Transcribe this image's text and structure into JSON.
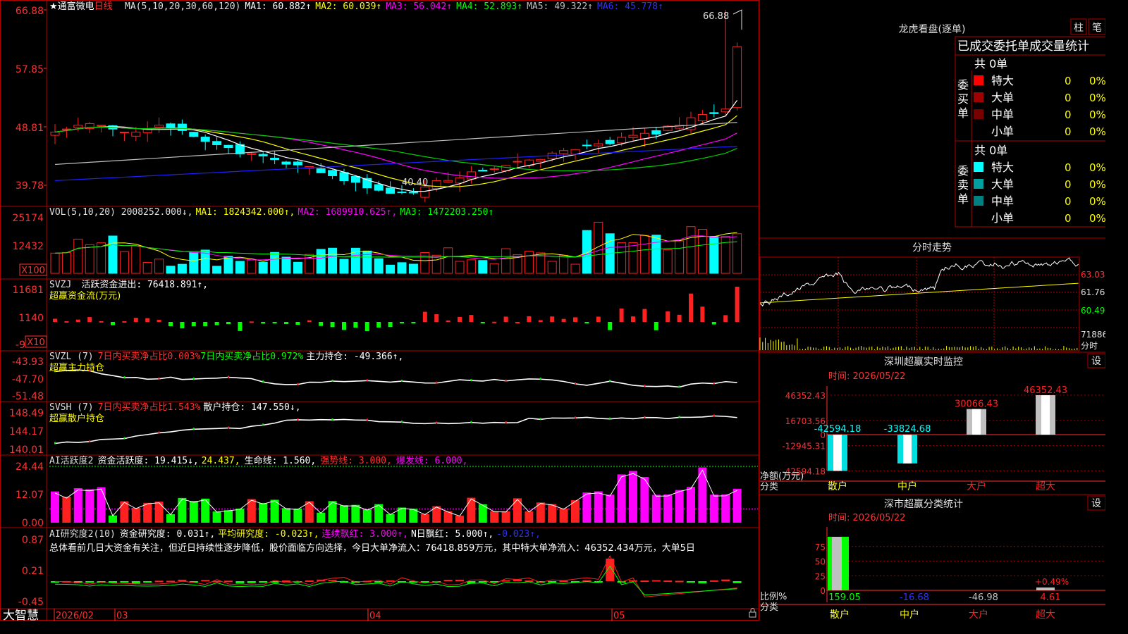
{
  "stock": {
    "name": "通富微电",
    "period": "日线",
    "brand": "大智慧"
  },
  "colors": {
    "up": "#ff2020",
    "down": "#00ffff",
    "grid": "#a00000",
    "axis": "#ff3030",
    "ma1": "#ffffff",
    "ma2": "#ffff00",
    "ma3": "#ff00ff",
    "ma4": "#00d000",
    "ma5": "#c0c0c0",
    "ma6": "#2020ff",
    "green": "#00ff00",
    "magenta": "#ff00ff",
    "yellow": "#ffff00"
  },
  "kline": {
    "header": {
      "star": "★",
      "ma_def": "MA(5,10,20,30,60,120)",
      "ma1": "MA1: 60.882↑",
      "ma2": "MA2: 60.039↑",
      "ma3": "MA3: 56.042↑",
      "ma4": "MA4: 52.893↑",
      "ma5": "MA5: 49.322↑",
      "ma6": "MA6: 45.778↑"
    },
    "axis": [
      "66.88",
      "57.85",
      "48.81",
      "39.78"
    ],
    "high_label": "66.88",
    "low_label": "40.40"
  },
  "vol": {
    "header": {
      "def": "VOL(5,10,20) 2008252.000↓,",
      "ma1": "MA1: 1824342.000↑,",
      "ma2": "MA2: 1689910.625↑,",
      "ma3": "MA3: 1472203.250↑"
    },
    "axis": [
      "25174",
      "12432"
    ],
    "unit": "X100"
  },
  "svzj": {
    "header": {
      "name": "SVZJ",
      "text": "活跃资金进出: 76418.891↑,",
      "sub": "超赢资金流(万元)"
    },
    "axis": [
      "11681",
      "1140",
      "-9"
    ],
    "unit": "X10"
  },
  "svzl": {
    "header": {
      "name": "SVZL (7)",
      "t1": "7日内买卖净占比0.003%",
      "t2": "7日内买卖净占比0.972%",
      "t3": "主力持仓: -49.366↑,",
      "sub": "超赢主力持仓"
    },
    "axis": [
      "-43.93",
      "-47.70",
      "-51.48"
    ]
  },
  "svsh": {
    "header": {
      "name": "SVSH (7)",
      "t1": "7日内买卖净占比1.543%",
      "t2": "散户持仓: 147.550↓,",
      "sub": "超赢散户持仓"
    },
    "axis": [
      "148.49",
      "144.17",
      "140.01"
    ]
  },
  "ai2": {
    "header": {
      "name": "AI活跃度2",
      "t1": "资金活跃度: 19.415↓,",
      "t2": "24.437,",
      "t3": "生命线: 1.560,",
      "t4": "强势线: 3.000,",
      "t5": "爆发线: 6.000,"
    },
    "axis": [
      "24.44",
      "12.07",
      "0.00"
    ]
  },
  "ai3": {
    "header": {
      "name": "AI研究度2(10)",
      "t1": "资金研究度: 0.031↑,",
      "t2": "平均研究度: -0.023↑,",
      "t3": "连续飘红: 3.000↑,",
      "t4": "N日飘红: 5.000↑,",
      "t5": "-0.023↑,"
    },
    "desc": "总体看前几日大资金有关注，但近日持续性逐步降低，股价面临方向选择，今日大单净流入：76418.859万元，其中特大单净流入：46352.434万元，大单5日",
    "axis": [
      "0.87",
      "0.21",
      "-0.45"
    ]
  },
  "dates": {
    "d1": "2026/02",
    "d2": "03",
    "d3": "04",
    "d4": "05"
  },
  "dragon": {
    "title": "龙虎看盘(逐单)",
    "btn1": "柱",
    "btn2": "笔",
    "subtitle": "已成交委托单成交量统计",
    "buy_label": "委买单",
    "sell_label": "委卖单",
    "buy_total": "共 0单",
    "sell_total": "共 0单",
    "buy_rows": [
      {
        "name": "特大",
        "count": "0",
        "pct": "0%"
      },
      {
        "name": "大单",
        "count": "0",
        "pct": "0%"
      },
      {
        "name": "中单",
        "count": "0",
        "pct": "0%"
      },
      {
        "name": "小单",
        "count": "0",
        "pct": "0%"
      }
    ],
    "sell_rows": [
      {
        "name": "特大",
        "count": "0",
        "pct": "0%"
      },
      {
        "name": "大单",
        "count": "0",
        "pct": "0%"
      },
      {
        "name": "中单",
        "count": "0",
        "pct": "0%"
      },
      {
        "name": "小单",
        "count": "0",
        "pct": "0%"
      }
    ]
  },
  "intraday": {
    "title": "分时走势",
    "axis": [
      "63.03",
      "61.76",
      "60.49",
      "71886"
    ],
    "unit": "分时"
  },
  "monitor": {
    "title": "深圳超赢实时监控",
    "btn": "设",
    "time": "时间: 2026/05/22",
    "axis": [
      "46352.43",
      "16703.56",
      "0",
      "-12945.31",
      "-42594.18"
    ],
    "ylabel": "净额(万元)",
    "xlabel": "分类",
    "cats": [
      "散户",
      "中户",
      "大户",
      "超大"
    ],
    "values": [
      -42594.18,
      -33824.68,
      30066.43,
      46352.43
    ],
    "value_labels": [
      "-42594.18",
      "-33824.68",
      "30066.43",
      "46352.43"
    ]
  },
  "classify": {
    "title": "深市超赢分类统计",
    "btn": "设",
    "time": "时间: 2026/05/22",
    "axis": [
      "75",
      "50",
      "25",
      "0"
    ],
    "ylabel": "比例%",
    "xlabel": "分类",
    "cats": [
      "散户",
      "中户",
      "大户",
      "超大"
    ],
    "values": [
      159.05,
      -16.68,
      -46.98,
      4.61
    ],
    "value_labels": [
      "159.05",
      "-16.68",
      "-46.98",
      "4.61"
    ],
    "note": "+0.49%"
  },
  "chart_data": [
    {
      "type": "candlestick",
      "title": "通富微电 日线",
      "y_ticks": [
        66.88,
        57.85,
        48.81,
        39.78
      ],
      "high": 66.88,
      "low": 40.4,
      "ma_last": {
        "MA5": 60.882,
        "MA10": 60.039,
        "MA20": 56.042,
        "MA30": 52.893,
        "MA60": 49.322,
        "MA120": 45.778
      }
    },
    {
      "type": "bar",
      "title": "VOL(5,10,20)",
      "y_ticks": [
        25174,
        12432
      ],
      "last": 2008252.0,
      "ma": [
        1824342.0,
        1689910.625,
        1472203.25
      ]
    },
    {
      "type": "bar",
      "title": "SVZJ 超赢资金流(万元)",
      "y_ticks": [
        11681,
        1140,
        -9
      ],
      "last": 76418.891
    },
    {
      "type": "line",
      "title": "SVZL 超赢主力持仓",
      "y_ticks": [
        -43.93,
        -47.7,
        -51.48
      ],
      "last": -49.366
    },
    {
      "type": "line",
      "title": "SVSH 超赢散户持仓",
      "y_ticks": [
        148.49,
        144.17,
        140.01
      ],
      "last": 147.55
    },
    {
      "type": "bar",
      "title": "AI活跃度2",
      "y_ticks": [
        24.44,
        12.07,
        0.0
      ],
      "last": 19.415
    },
    {
      "type": "bar",
      "title": "AI研究度2(10)",
      "y_ticks": [
        0.87,
        0.21,
        -0.45
      ],
      "last": 0.031
    },
    {
      "type": "bar",
      "title": "深圳超赢实时监控",
      "categories": [
        "散户",
        "中户",
        "大户",
        "超大"
      ],
      "values": [
        -42594.18,
        -33824.68,
        30066.43,
        46352.43
      ],
      "ylabel": "净额(万元)"
    },
    {
      "type": "bar",
      "title": "深市超赢分类统计",
      "categories": [
        "散户",
        "中户",
        "大户",
        "超大"
      ],
      "values": [
        159.05,
        -16.68,
        -46.98,
        4.61
      ],
      "ylabel": "比例%"
    }
  ]
}
